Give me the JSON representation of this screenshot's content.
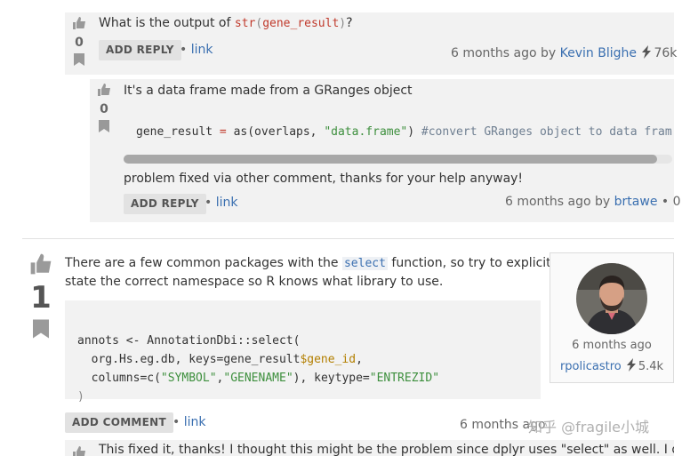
{
  "comment1": {
    "votes": "0",
    "text_prefix": "What is the output of ",
    "code": {
      "fn": "str",
      "open": "(",
      "arg": "gene_result",
      "close": ")"
    },
    "text_suffix": "?",
    "add_reply_label": "ADD REPLY",
    "link_label": "link",
    "time": "6 months ago by ",
    "user": "Kevin Blighe",
    "rep": "76k"
  },
  "comment2": {
    "votes": "0",
    "text": "It's a data frame made from a GRanges object",
    "code_line": {
      "a": "gene_result ",
      "eq": "=",
      "b": " as(overlaps, ",
      "str": "\"data.frame\"",
      "c": ") ",
      "comment": "#convert GRanges object to data frame"
    },
    "followup": "problem fixed via other comment, thanks for your help anyway!",
    "add_reply_label": "ADD REPLY",
    "link_label": "link",
    "time": "6 months ago by ",
    "user": "brtawe",
    "rep": "0"
  },
  "answer": {
    "votes": "1",
    "text_a": "There are a few common packages with the ",
    "inline_code": "select",
    "text_b": " function, so try to explicitly",
    "text_c": "state the correct namespace so R knows what library to use.",
    "code": {
      "l1a": "annots <- AnnotationDbi::select(",
      "l2a": "  org.Hs.eg.db, keys=gene_result",
      "l2b": "$gene_id",
      "l2c": ",",
      "l3a": "  columns=c(",
      "l3s1": "\"SYMBOL\"",
      "l3c": ",",
      "l3s2": "\"GENENAME\"",
      "l3d": "), keytype=",
      "l3s3": "\"ENTREZID\"",
      "l4": ")"
    },
    "add_comment_label": "ADD COMMENT",
    "link_label": "link",
    "time": "6 months ago",
    "user": "rpolicastro",
    "rep": "5.4k",
    "footer_meta": "6 months ago",
    "watermark": "知乎 @fragile小城"
  },
  "comment3": {
    "text": "This fixed it, thanks! I thought this might be the problem since dplyr uses \"select\" as well. I did"
  },
  "icons": {
    "thumb": "thumbs-up-icon",
    "bookmark": "bookmark-icon",
    "bolt": "lightning-icon"
  }
}
